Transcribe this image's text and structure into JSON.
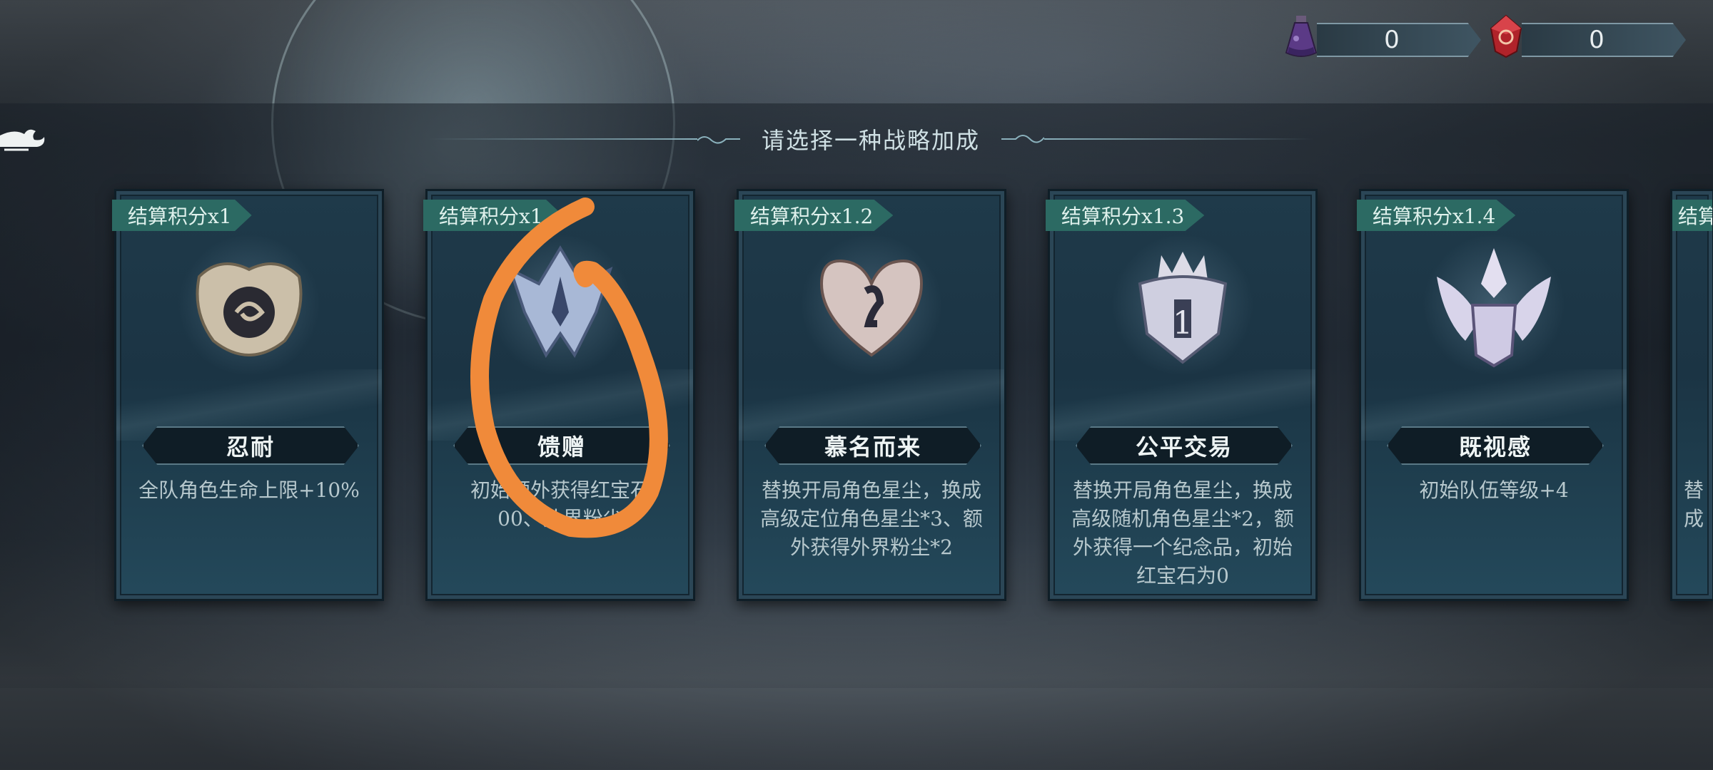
{
  "currencies": [
    {
      "icon": "potion-flask-icon",
      "value": "0"
    },
    {
      "icon": "red-gem-icon",
      "value": "0"
    }
  ],
  "back_icon": "beast-back-icon",
  "prompt": "请选择一种战略加成",
  "cards": [
    {
      "tag": "结算积分x1",
      "name": "忍耐",
      "desc": "全队角色生命上限+10%",
      "emblem": "serpent-crest-icon"
    },
    {
      "tag": "结算积分x1",
      "name": "馈赠",
      "desc": "初始额外获得红宝石 00、外界粉尘",
      "emblem": "tribal-crest-icon"
    },
    {
      "tag": "结算积分x1.2",
      "name": "慕名而来",
      "desc": "替换开局角色星尘，换成高级定位角色星尘*3、额外获得外界粉尘*2",
      "emblem": "dragon-heart-crest-icon"
    },
    {
      "tag": "结算积分x1.3",
      "name": "公平交易",
      "desc": "替换开局角色星尘，换成高级随机角色星尘*2，额外获得一个纪念品，初始红宝石为0",
      "emblem": "crowned-beast-crest-icon"
    },
    {
      "tag": "结算积分x1.4",
      "name": "既视感",
      "desc": "初始队伍等级+4",
      "emblem": "winged-helm-crest-icon"
    },
    {
      "tag": "结算",
      "name": "",
      "desc": "替成",
      "emblem": ""
    }
  ],
  "annotation": {
    "color": "#f08a3a"
  }
}
